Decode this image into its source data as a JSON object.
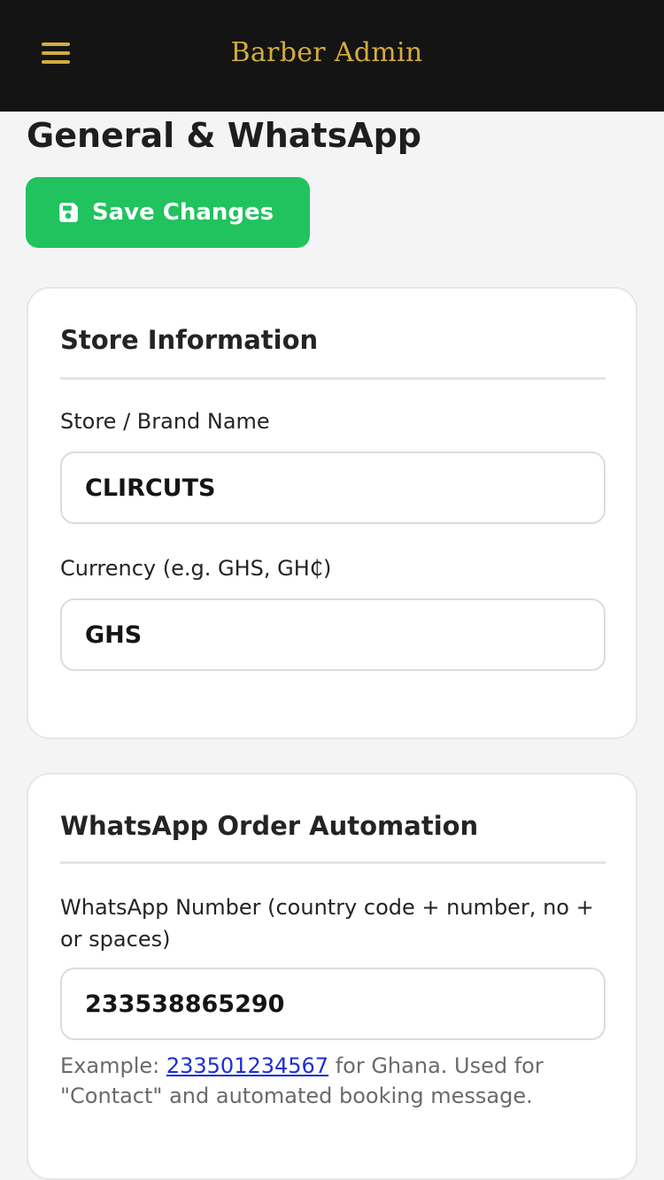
{
  "header": {
    "brand": "Barber Admin",
    "menu_icon": "hamburger-menu-icon",
    "accent_color": "#d4ac3e",
    "background_color": "#141414"
  },
  "page": {
    "title": "General & WhatsApp"
  },
  "toolbar": {
    "save_label": "Save Changes",
    "save_icon": "floppy-disk-icon",
    "save_color": "#20c35e"
  },
  "store_info": {
    "title": "Store Information",
    "brand_name_label": "Store / Brand Name",
    "brand_name_value": "CLIRCUTS",
    "currency_label": "Currency (e.g. GHS, GH₵)",
    "currency_value": "GHS"
  },
  "whatsapp": {
    "title": "WhatsApp Order Automation",
    "number_label": "WhatsApp Number (country code + number, no + or spaces)",
    "number_value": "233538865290",
    "help_prefix": "Example: ",
    "help_link": "233501234567",
    "help_suffix": " for Ghana. Used for \"Contact\" and automated booking message."
  }
}
